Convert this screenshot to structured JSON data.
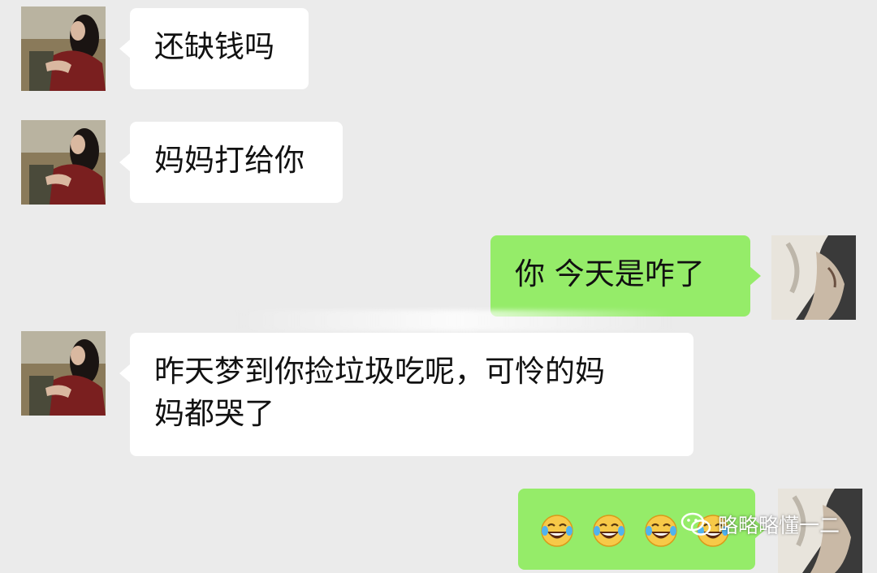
{
  "messages": [
    {
      "side": "in",
      "text": "还缺钱吗"
    },
    {
      "side": "in",
      "text": "妈妈打给你"
    },
    {
      "side": "out",
      "text": "你 今天是咋了"
    },
    {
      "side": "in",
      "line1": "昨天梦到你捡垃圾吃呢，可怜的妈",
      "line2": "妈都哭了"
    },
    {
      "side": "out",
      "emoji_count": 4,
      "emoji": "laughing-crying-face"
    }
  ],
  "avatars": {
    "mother": "woman-portrait-avatar",
    "self": "anime-character-avatar"
  },
  "watermark": {
    "text": "略略略懂一二",
    "icon": "wechat-icon"
  },
  "colors": {
    "background": "#ebebeb",
    "incoming": "#ffffff",
    "outgoing": "#95ec69"
  }
}
